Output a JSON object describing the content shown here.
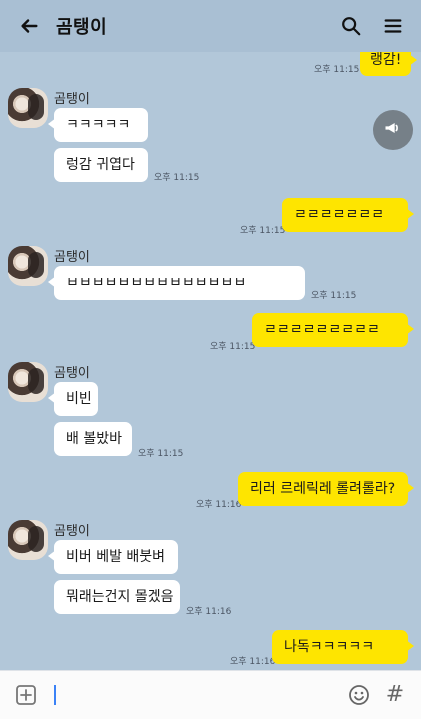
{
  "header": {
    "title": "곰탱이"
  },
  "messages": [
    {
      "id": "m0",
      "side": "right",
      "text": "랭감!",
      "time": "오후 11:15",
      "style": "yellow"
    },
    {
      "id": "m1",
      "side": "left",
      "name": "곰탱이",
      "text": "ㅋㅋㅋㅋㅋ",
      "time": ""
    },
    {
      "id": "m2",
      "side": "left",
      "text": "렁감 귀엽다",
      "time": "오후 11:15"
    },
    {
      "id": "m3",
      "side": "right",
      "text": "ㄹㄹㄹㄹㄹㄹㄹ",
      "time": "오후 11:15"
    },
    {
      "id": "m4",
      "side": "left",
      "name": "곰탱이",
      "text": "ㅂㅂㅂㅂㅂㅂㅂㅂㅂㅂㅂㅂㅂㅂ",
      "time": "오후 11:15"
    },
    {
      "id": "m5",
      "side": "right",
      "text": "ㄹㄹㄹㄹㄹㄹㄹㄹㄹ",
      "time": "오후 11:15"
    },
    {
      "id": "m6",
      "side": "left",
      "name": "곰탱이",
      "text": "비빈",
      "time": ""
    },
    {
      "id": "m7",
      "side": "left",
      "text": "배 볼밨바",
      "time": "오후 11:15"
    },
    {
      "id": "m8",
      "side": "right",
      "text": "리러 르레릭레 롤려롤라?",
      "time": "오후 11:16"
    },
    {
      "id": "m9",
      "side": "left",
      "name": "곰탱이",
      "text": "비버 베발 배붓벼",
      "time": ""
    },
    {
      "id": "m10",
      "side": "left",
      "text": "뭐래는건지 몰겠음",
      "time": "오후 11:16"
    },
    {
      "id": "m11",
      "side": "right",
      "text": "나독ㅋㅋㅋㅋㅋ",
      "time": "오후 11:16"
    }
  ],
  "input": {
    "placeholder": ""
  },
  "icons": {
    "back": "back-arrow-icon",
    "search": "search-icon",
    "menu": "menu-icon",
    "speaker": "megaphone-icon",
    "plus": "plus-icon",
    "emoji": "emoji-icon",
    "hash": "hash-icon"
  },
  "colors": {
    "background": "#b2c7d9",
    "header": "#a9bfd3",
    "yellow_bubble": "#fee500",
    "white_bubble": "#ffffff"
  }
}
